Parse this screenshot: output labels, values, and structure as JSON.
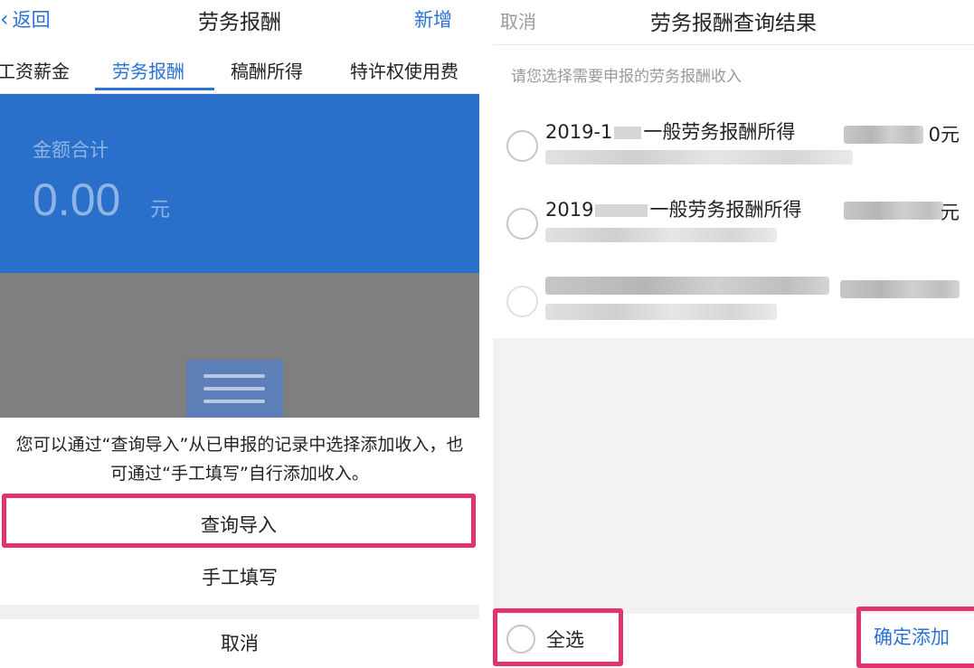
{
  "left": {
    "nav": {
      "back": "返回",
      "title": "劳务报酬",
      "add": "新增"
    },
    "tabs": [
      "工资薪金",
      "劳务报酬",
      "稿酬所得",
      "特许权使用费"
    ],
    "active_tab": 1,
    "banner": {
      "label": "金额合计",
      "amount": "0.00",
      "unit": "元"
    },
    "sheet": {
      "message": "您可以通过“查询导入”从已申报的记录中选择添加收入，也可通过“手工填写”自行添加收入。",
      "query_import": "查询导入",
      "manual_fill": "手工填写",
      "cancel": "取消"
    }
  },
  "right": {
    "nav": {
      "cancel": "取消",
      "title": "劳务报酬查询结果"
    },
    "hint": "请您选择需要申报的劳务报酬收入",
    "records": [
      {
        "prefix": "2019-1",
        "type": "一般劳务报酬所得",
        "amount_suffix": "0元"
      },
      {
        "prefix": "2019",
        "type": "一般劳务报酬所得",
        "amount_suffix": "元"
      }
    ],
    "footer": {
      "select_all": "全选",
      "confirm_add": "确定添加"
    }
  },
  "colors": {
    "accent": "#2a72d8",
    "highlight": "#e0336f",
    "banner": "#2a6fc9"
  }
}
